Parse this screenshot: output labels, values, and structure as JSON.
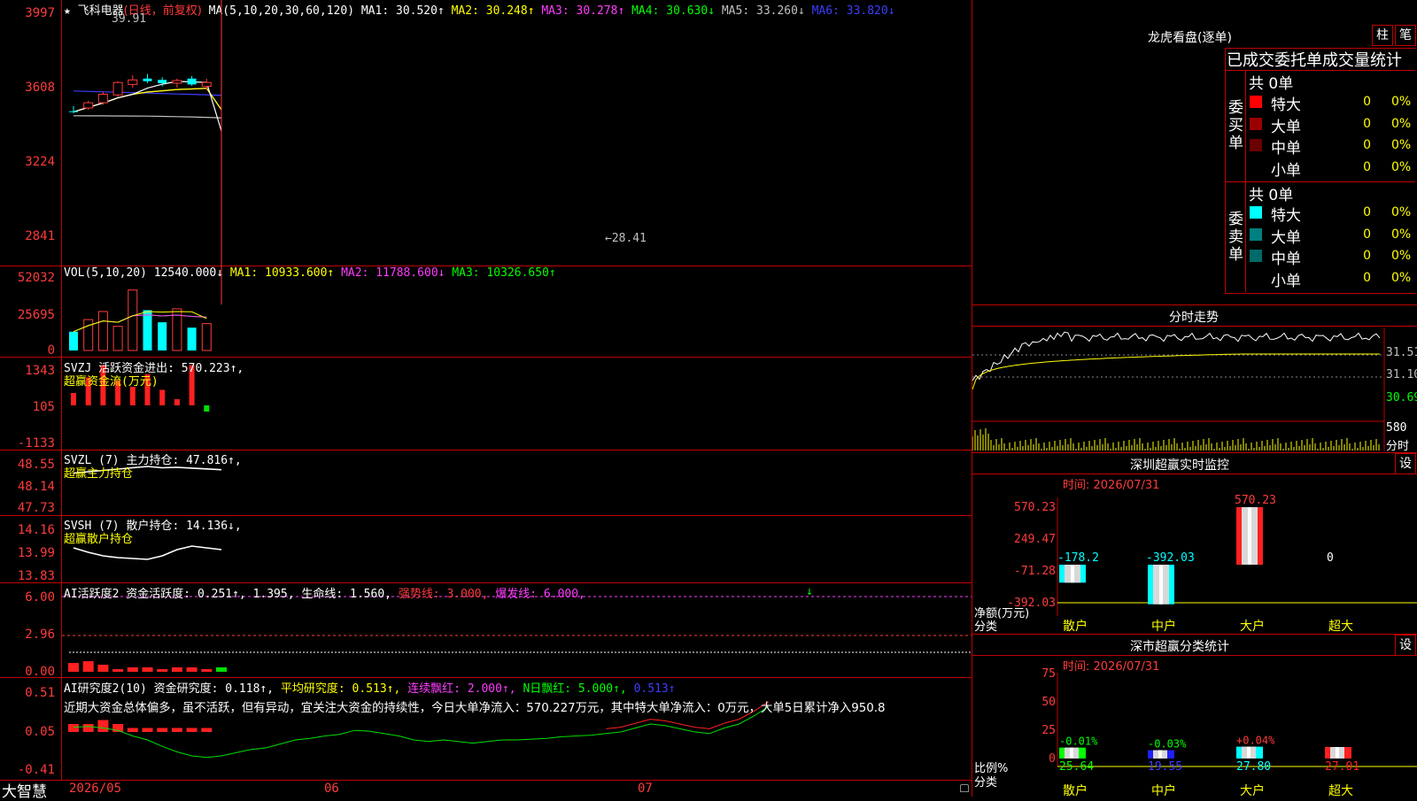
{
  "stock": {
    "star": "★",
    "name": "飞科电器",
    "period": "(日线，前复权)"
  },
  "ma_line": {
    "title": "MA(5,10,20,30,60,120)",
    "items": [
      {
        "label": "MA1: 30.520↑",
        "color": "#ffffff"
      },
      {
        "label": "MA2: 30.248↑",
        "color": "#ffff00"
      },
      {
        "label": "MA3: 30.278↑",
        "color": "#ff3cff"
      },
      {
        "label": "MA4: 30.630↓",
        "color": "#00ff00"
      },
      {
        "label": "MA5: 33.260↓",
        "color": "#c0c0c0"
      },
      {
        "label": "MA6: 33.820↓",
        "color": "#3d3dff"
      }
    ]
  },
  "price_axis": [
    "3997",
    "3608",
    "3224",
    "2841"
  ],
  "high_mark": "39.91",
  "low_mark": "←28.41",
  "vol": {
    "title": "VOL(5,10,20)",
    "value": "12540.000↓",
    "items": [
      {
        "label": "MA1: 10933.600↑",
        "color": "#ffff00"
      },
      {
        "label": "MA2: 11788.600↓",
        "color": "#ff3cff"
      },
      {
        "label": "MA3: 10326.650↑",
        "color": "#00ff00"
      }
    ],
    "axis": [
      "52032",
      "25695",
      "0"
    ]
  },
  "svzj": {
    "title": "SVZJ  活跃资金进出: 570.223↑,",
    "sub": "超赢资金流(万元)",
    "axis": [
      "1343",
      "105",
      "-1133"
    ]
  },
  "svzl": {
    "title": "SVZL (7) 主力持仓: 47.816↑,",
    "sub": "超赢主力持仓",
    "axis": [
      "48.55",
      "48.14",
      "47.73"
    ]
  },
  "svsh": {
    "title": "SVSH (7) 散户持仓: 14.136↓,",
    "sub": "超赢散户持仓",
    "axis": [
      "14.16",
      "13.99",
      "13.83"
    ]
  },
  "ai_active": {
    "title": "AI活跃度2 资金活跃度: 0.251↑, 1.395, 生命线: 1.560,",
    "strong": "强势线: 3.000,",
    "burst": "爆发线: 6.000,",
    "axis": [
      "6.00",
      "2.96",
      "0.00"
    ]
  },
  "ai_research": {
    "title": "AI研究度2(10) 资金研究度: 0.118↑,",
    "avg": "平均研究度: 0.513↑,",
    "cont": "连续飘红: 2.000↑,",
    "nday": "N日飘红: 5.000↑,",
    "last": "0.513↑",
    "comment": "近期大资金总体偏多，虽不活跃，但有异动，宜关注大资金的持续性，今日大单净流入：570.227万元，其中特大单净流入：0万元，大单5日累计净入950.8",
    "axis": [
      "0.51",
      "0.05",
      "-0.41"
    ]
  },
  "bottom": {
    "brand": "大智慧",
    "dates": [
      "2026/05",
      "06",
      "07"
    ]
  },
  "lhkp": {
    "title": "龙虎看盘(逐单)",
    "btn1": "柱",
    "btn2": "笔",
    "header": "已成交委托单成交量统计",
    "buy_label": "委买单",
    "sell_label": "委卖单",
    "buy_total": "共 0单",
    "sell_total": "共 0单",
    "buy_rows": [
      {
        "name": "特大",
        "v1": "0",
        "v2": "0%",
        "color": "#ff0000"
      },
      {
        "name": "大单",
        "v1": "0",
        "v2": "0%",
        "color": "#9a0000"
      },
      {
        "name": "中单",
        "v1": "0",
        "v2": "0%",
        "color": "#6a0000"
      },
      {
        "name": "小单",
        "v1": "0",
        "v2": "0%",
        "color": "#000000"
      }
    ],
    "sell_rows": [
      {
        "name": "特大",
        "v1": "0",
        "v2": "0%",
        "color": "#00ffff"
      },
      {
        "name": "大单",
        "v1": "0",
        "v2": "0%",
        "color": "#008080"
      },
      {
        "name": "中单",
        "v1": "0",
        "v2": "0%",
        "color": "#006a6a"
      },
      {
        "name": "小单",
        "v1": "0",
        "v2": "0%",
        "color": "#000000"
      }
    ]
  },
  "intraday": {
    "title": "分时走势",
    "axis": [
      "31.51",
      "31.10",
      "30.69"
    ],
    "vol_axis": [
      "580",
      "分时"
    ]
  },
  "monitor": {
    "title": "深圳超赢实时监控",
    "btn": "设",
    "time": "时间: 2026/07/31",
    "axis": [
      "570.23",
      "249.47",
      "-71.28",
      "-392.03"
    ],
    "ylab1": "净额(万元)",
    "ylab2": "分类",
    "cats": [
      "散户",
      "中户",
      "大户",
      "超大"
    ],
    "values": [
      -178.2,
      -392.03,
      570.23,
      0
    ],
    "value_labels": [
      "-178.2",
      "-392.03",
      "570.23",
      "0"
    ]
  },
  "stats": {
    "title": "深市超赢分类统计",
    "btn": "设",
    "time": "时间: 2026/07/31",
    "axis": [
      "75",
      "50",
      "25",
      "0"
    ],
    "ylab1": "比例%",
    "ylab2": "分类",
    "cats": [
      "散户",
      "中户",
      "大户",
      "超大"
    ],
    "values": [
      25.64,
      19.55,
      27.8,
      27.01
    ],
    "value_labels": [
      "25.64",
      "19.55",
      "27.80",
      "27.01"
    ],
    "deltas": [
      "-0.01%",
      "-0.03%",
      "+0.04%",
      ""
    ]
  },
  "chart_data": {
    "type": "candlestick",
    "ohlc": [
      [
        32.6,
        33.4,
        32.3,
        32.5
      ],
      [
        33.1,
        34.2,
        32.8,
        33.9
      ],
      [
        33.9,
        35.6,
        33.6,
        35.2
      ],
      [
        35.1,
        37.2,
        34.8,
        37.0
      ],
      [
        36.7,
        38.1,
        36.2,
        37.4
      ],
      [
        37.6,
        38.3,
        36.9,
        37.2
      ],
      [
        37.4,
        37.8,
        36.4,
        36.9
      ],
      [
        36.9,
        37.6,
        36.2,
        37.3
      ],
      [
        37.6,
        38.0,
        36.5,
        36.7
      ],
      [
        36.4,
        37.6,
        35.9,
        37.0
      ],
      "(+38 more)"
    ],
    "volume": [
      14000,
      23000,
      29000,
      18000,
      45000,
      30000,
      21000,
      31000,
      17000,
      20000,
      "(+38 more)"
    ],
    "fund_flow": [
      400,
      900,
      1300,
      800,
      600,
      1000,
      500,
      200,
      1300,
      -200,
      "(+38 more)"
    ],
    "ai_research_hist": [
      0.1,
      0.1,
      0.15,
      0.1,
      0.05,
      0.05,
      0.05,
      0.05,
      0.05,
      0.05,
      "(+38 more)"
    ]
  }
}
